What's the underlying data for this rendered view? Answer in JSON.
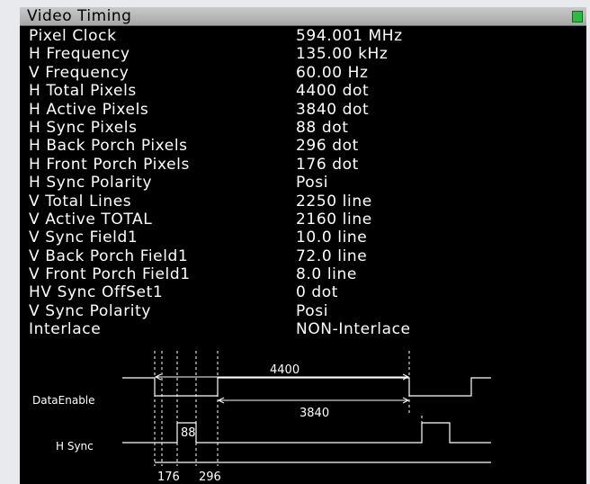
{
  "window": {
    "title": "Video Timing"
  },
  "timing_rows": [
    {
      "label": "Pixel Clock",
      "value": "594.001 MHz"
    },
    {
      "label": "H Frequency",
      "value": "135.00 kHz"
    },
    {
      "label": "V Frequency",
      "value": "60.00 Hz"
    },
    {
      "label": "H Total Pixels",
      "value": "4400 dot"
    },
    {
      "label": "H Active Pixels",
      "value": "3840 dot"
    },
    {
      "label": "H Sync Pixels",
      "value": "88 dot"
    },
    {
      "label": "H Back Porch Pixels",
      "value": "296 dot"
    },
    {
      "label": "H Front Porch Pixels",
      "value": "176 dot"
    },
    {
      "label": "H Sync Polarity",
      "value": "Posi"
    },
    {
      "label": "V Total Lines",
      "value": "2250 line"
    },
    {
      "label": "V Active TOTAL",
      "value": "2160 line"
    },
    {
      "label": "V Sync Field1",
      "value": "10.0 line"
    },
    {
      "label": "V Back Porch Field1",
      "value": "72.0 line"
    },
    {
      "label": "V Front Porch Field1",
      "value": "8.0 line"
    },
    {
      "label": "HV Sync OffSet1",
      "value": "0 dot"
    },
    {
      "label": "V Sync Polarity",
      "value": "Posi"
    },
    {
      "label": "Interlace",
      "value": "NON-Interlace"
    }
  ],
  "diagram": {
    "data_enable_label": "DataEnable",
    "h_sync_label": "H Sync",
    "total_label": "4400",
    "active_label": "3840",
    "sync_label": "88",
    "front_porch_label": "176",
    "back_porch_label": "296"
  },
  "colors": {
    "panel_background": "#000000",
    "text": "#ffffff",
    "status_indicator": "#2dbb42"
  }
}
